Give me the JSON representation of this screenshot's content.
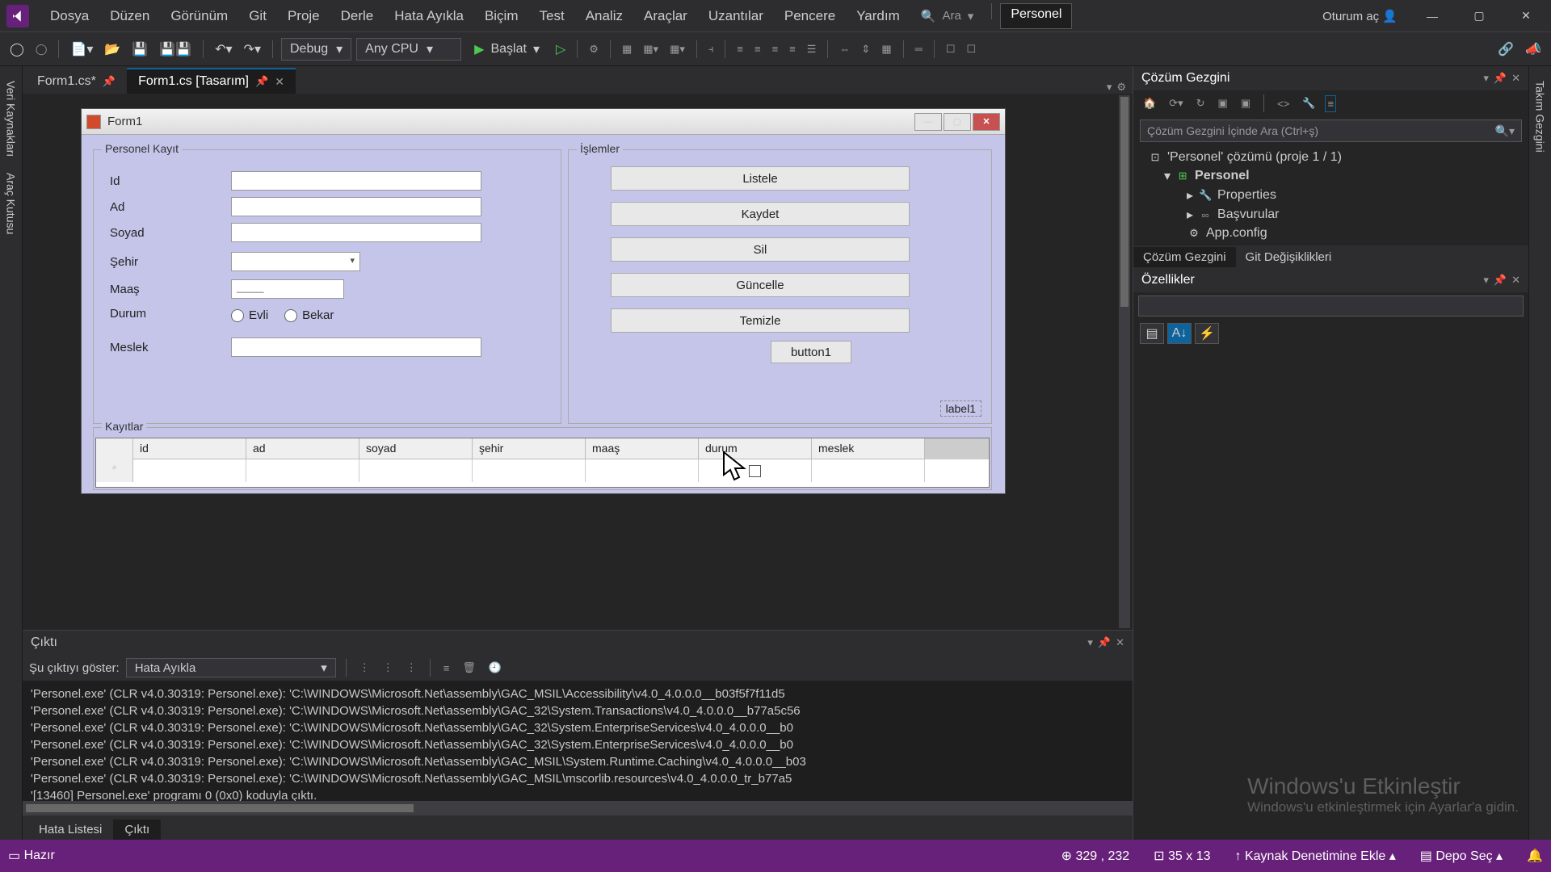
{
  "menu": {
    "dosya": "Dosya",
    "duzen": "Düzen",
    "gorunum": "Görünüm",
    "git": "Git",
    "proje": "Proje",
    "derle": "Derle",
    "hata": "Hata Ayıkla",
    "bicim": "Biçim",
    "test": "Test",
    "analiz": "Analiz",
    "araclar": "Araçlar",
    "uzantilar": "Uzantılar",
    "pencere": "Pencere",
    "yardim": "Yardım"
  },
  "search": {
    "label": "Ara",
    "arrow": "▾"
  },
  "project_name": "Personel",
  "signin": "Oturum aç",
  "toolbar": {
    "config": "Debug",
    "platform": "Any CPU",
    "start": "Başlat"
  },
  "tabs": {
    "code": "Form1.cs*",
    "design": "Form1.cs [Tasarım]"
  },
  "sidebar_left": {
    "veri": "Veri Kaynakları",
    "arac": "Araç Kutusu"
  },
  "sidebar_right": {
    "takim": "Takım Gezgini"
  },
  "form": {
    "title": "Form1",
    "gb_kayit": "Personel Kayıt",
    "gb_islemler": "İşlemler",
    "gb_kayitlar": "Kayıtlar",
    "labels": {
      "id": "Id",
      "ad": "Ad",
      "soyad": "Soyad",
      "sehir": "Şehir",
      "maas": "Maaş",
      "durum": "Durum",
      "meslek": "Meslek"
    },
    "radios": {
      "evli": "Evli",
      "bekar": "Bekar"
    },
    "buttons": {
      "listele": "Listele",
      "kaydet": "Kaydet",
      "sil": "Sil",
      "guncelle": "Güncelle",
      "temizle": "Temizle",
      "extra": "button1"
    },
    "floating_label": "label1",
    "grid": {
      "id": "id",
      "ad": "ad",
      "soyad": "soyad",
      "sehir": "şehir",
      "maas": "maaş",
      "durum": "durum",
      "meslek": "meslek",
      "row_marker": "*"
    }
  },
  "output": {
    "panel_title": "Çıktı",
    "show_label": "Şu çıktıyı göster:",
    "show_value": "Hata Ayıkla",
    "lines": [
      "'Personel.exe' (CLR v4.0.30319: Personel.exe): 'C:\\WINDOWS\\Microsoft.Net\\assembly\\GAC_MSIL\\Accessibility\\v4.0_4.0.0.0__b03f5f7f11d5",
      "'Personel.exe' (CLR v4.0.30319: Personel.exe): 'C:\\WINDOWS\\Microsoft.Net\\assembly\\GAC_32\\System.Transactions\\v4.0_4.0.0.0__b77a5c56",
      "'Personel.exe' (CLR v4.0.30319: Personel.exe): 'C:\\WINDOWS\\Microsoft.Net\\assembly\\GAC_32\\System.EnterpriseServices\\v4.0_4.0.0.0__b0",
      "'Personel.exe' (CLR v4.0.30319: Personel.exe): 'C:\\WINDOWS\\Microsoft.Net\\assembly\\GAC_32\\System.EnterpriseServices\\v4.0_4.0.0.0__b0",
      "'Personel.exe' (CLR v4.0.30319: Personel.exe): 'C:\\WINDOWS\\Microsoft.Net\\assembly\\GAC_MSIL\\System.Runtime.Caching\\v4.0_4.0.0.0__b03",
      "'Personel.exe' (CLR v4.0.30319: Personel.exe): 'C:\\WINDOWS\\Microsoft.Net\\assembly\\GAC_MSIL\\mscorlib.resources\\v4.0_4.0.0.0_tr_b77a5",
      "'[13460] Personel.exe' programı 0 (0x0) koduyla çıktı."
    ],
    "tabs": {
      "hata": "Hata Listesi",
      "cikti": "Çıktı"
    }
  },
  "solution": {
    "title": "Çözüm Gezgini",
    "search_placeholder": "Çözüm Gezgini İçinde Ara (Ctrl+ş)",
    "root": "'Personel' çözümü (proje 1 / 1)",
    "project": "Personel",
    "properties": "Properties",
    "refs": "Başvurular",
    "appconfig": "App.config",
    "tabs": {
      "sol": "Çözüm Gezgini",
      "git": "Git Değişiklikleri"
    }
  },
  "properties": {
    "title": "Özellikler"
  },
  "status": {
    "ready": "Hazır",
    "pos": "329 , 232",
    "size": "35 x 13",
    "src": "Kaynak Denetimine Ekle",
    "src_arrow": "▴",
    "repo": "Depo Seç",
    "repo_arrow": "▴"
  },
  "watermark": {
    "h": "Windows'u Etkinleştir",
    "p": "Windows'u etkinleştirmek için Ayarlar'a gidin."
  }
}
